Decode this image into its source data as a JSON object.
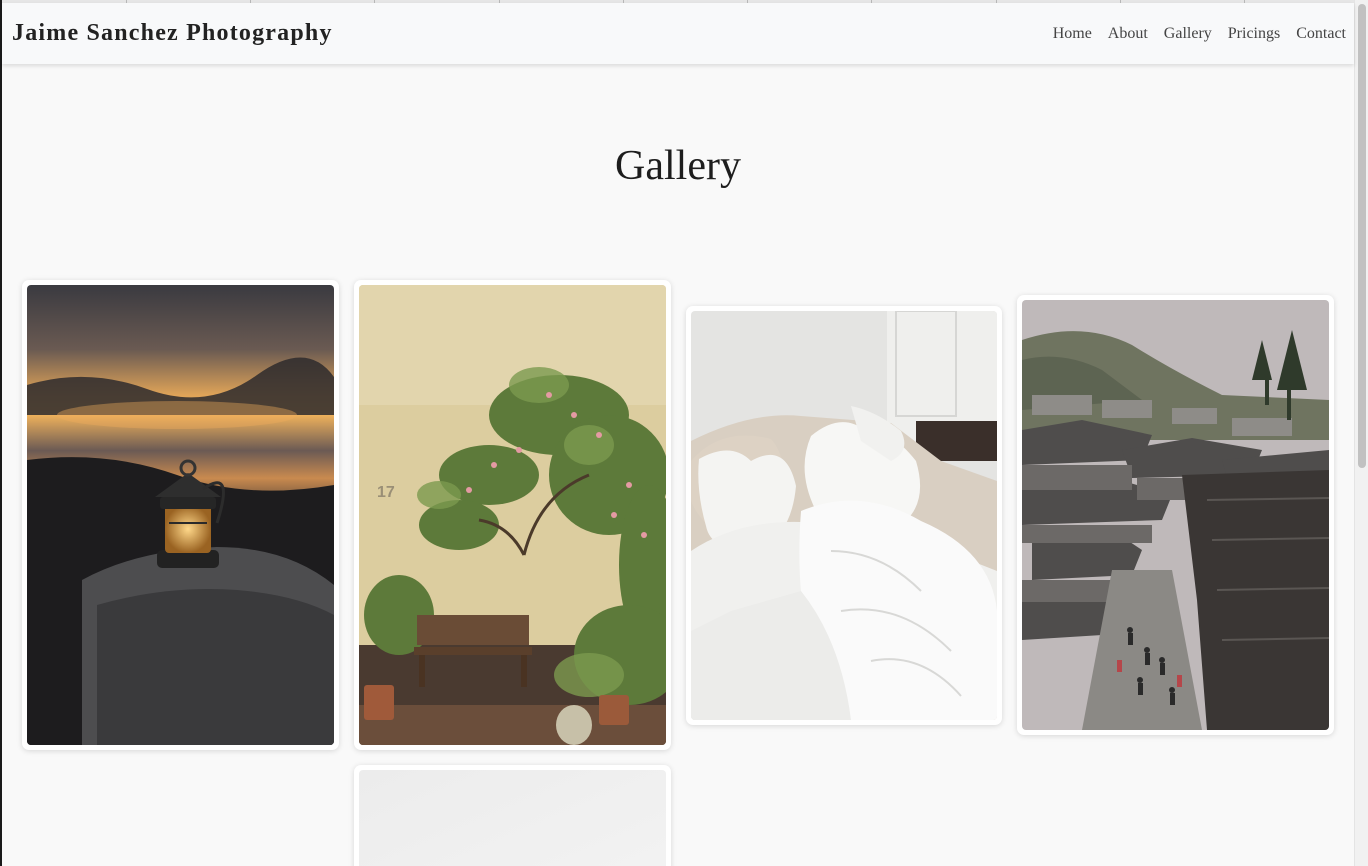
{
  "site": {
    "brand": "Jaime Sanchez Photography"
  },
  "nav": {
    "items": [
      {
        "label": "Home"
      },
      {
        "label": "About"
      },
      {
        "label": "Gallery"
      },
      {
        "label": "Pricings"
      },
      {
        "label": "Contact"
      }
    ]
  },
  "page": {
    "title": "Gallery"
  },
  "gallery": {
    "photos": [
      {
        "subject": "lantern on rock at sunset lake",
        "icon": "lantern-photo"
      },
      {
        "subject": "wooden bench under rose vine by yellow wall",
        "icon": "garden-bench-photo"
      },
      {
        "subject": "white pillows on unmade bed",
        "icon": "bed-pillows-photo"
      },
      {
        "subject": "old town street with traditional rooftops",
        "icon": "old-town-street-photo"
      },
      {
        "subject": "light grey photo partially visible",
        "icon": "placeholder-photo"
      }
    ]
  }
}
